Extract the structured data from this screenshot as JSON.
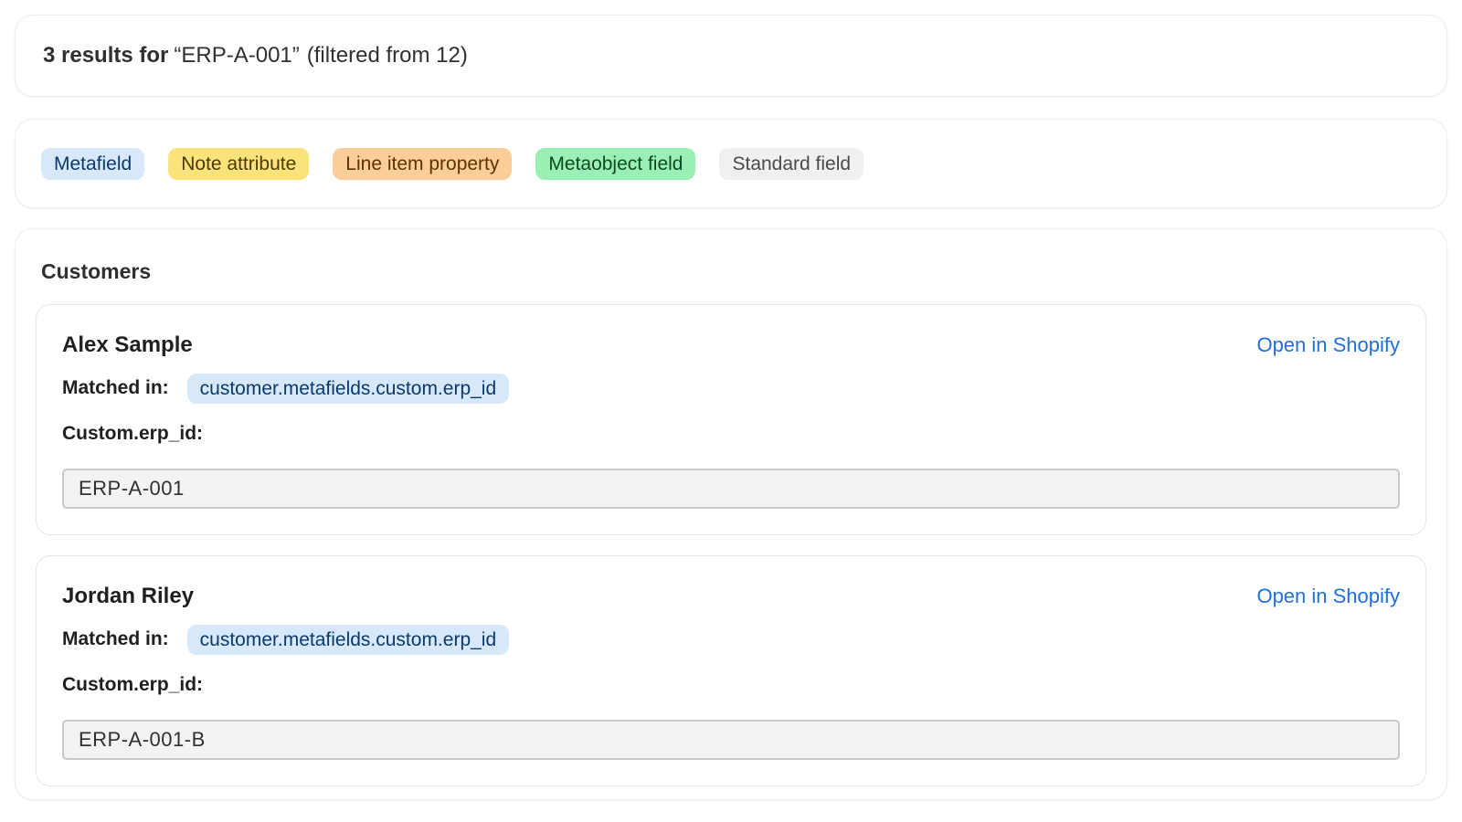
{
  "results": {
    "count_label": "3 results for",
    "query": "“ERP-A-001”",
    "filtered_note": "(filtered from 12)"
  },
  "legend": {
    "chips": [
      {
        "label": "Metafield",
        "color": "#d7e8fb"
      },
      {
        "label": "Note attribute",
        "color": "#fbe27a"
      },
      {
        "label": "Line item property",
        "color": "#fbcd98"
      },
      {
        "label": "Metaobject field",
        "color": "#9af0b4"
      },
      {
        "label": "Standard field",
        "color": "#f0f0f0"
      }
    ]
  },
  "section": {
    "title": "Customers",
    "results": [
      {
        "name": "Alex Sample",
        "open_link": "Open in Shopify",
        "matched_label": "Matched in:",
        "matched_path": "customer.metafields.custom.erp_id",
        "field_label": "Custom.erp_id:",
        "value": "ERP-A-001"
      },
      {
        "name": "Jordan Riley",
        "open_link": "Open in Shopify",
        "matched_label": "Matched in:",
        "matched_path": "customer.metafields.custom.erp_id",
        "field_label": "Custom.erp_id:",
        "value": "ERP-A-001-B"
      }
    ]
  },
  "colors": {
    "link": "#1f6fdc",
    "text": "#303030"
  }
}
